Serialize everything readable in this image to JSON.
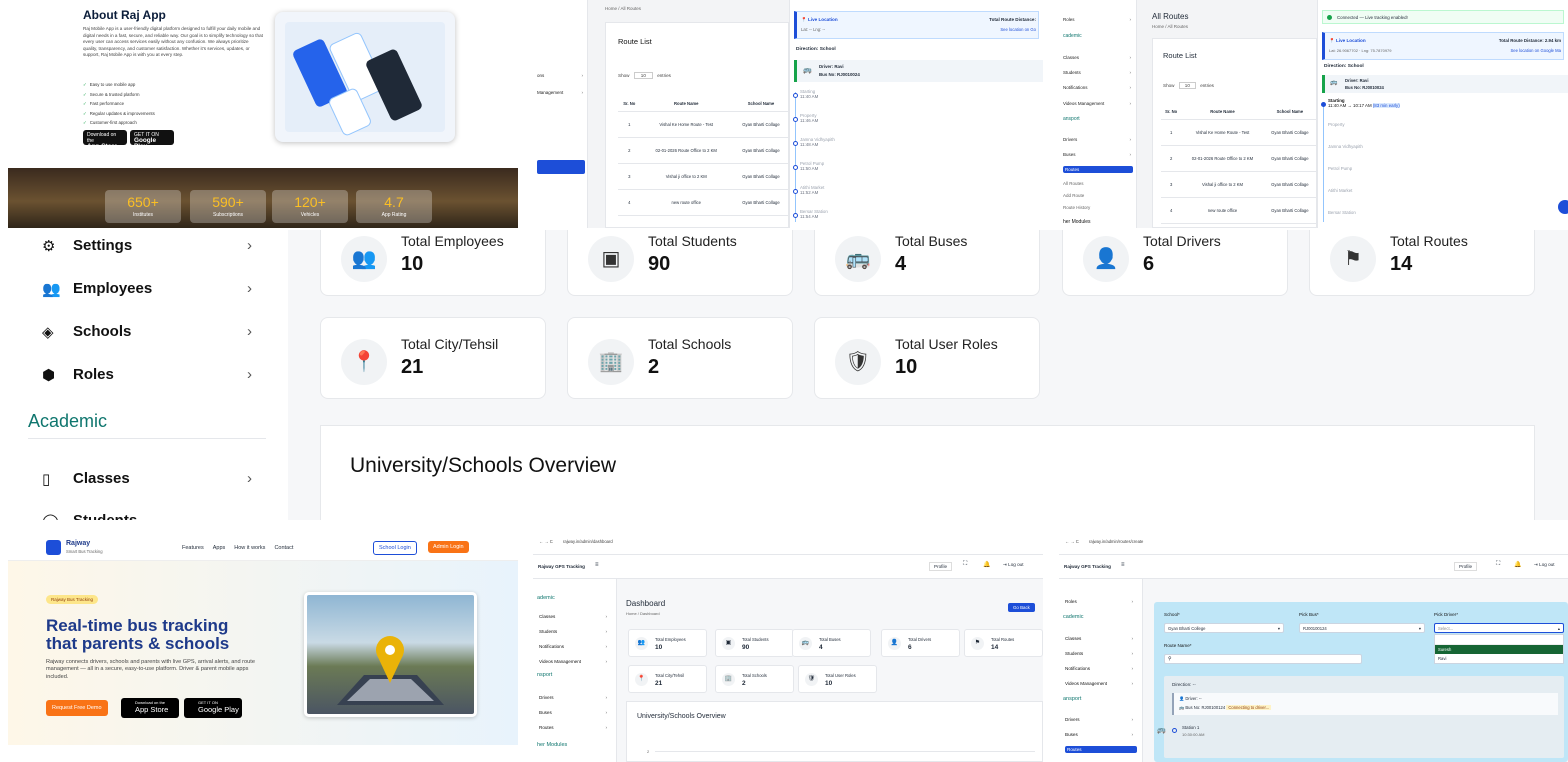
{
  "about": {
    "title": "About Raj App",
    "description": "Raj Mobile App is a user-friendly digital platform designed to fulfill your daily mobile and digital needs in a fast, secure, and reliable way. Our goal is to simplify technology so that every user can access services easily without any confusion. We always prioritize quality, transparency, and customer satisfaction. Whether it's services, updates, or support, Raj Mobile App is with you at every step.",
    "bullets": [
      "Easy to use mobile app",
      "Secure & trusted platform",
      "Fast performance",
      "Regular updates & improvements",
      "Customer-first approach"
    ],
    "appstore": {
      "top": "Download on the",
      "main": "App Store"
    },
    "googleplay": {
      "top": "GET IT ON",
      "main": "Google Play"
    },
    "stats": [
      {
        "value": "650+",
        "label": "Institutes"
      },
      {
        "value": "590+",
        "label": "Subscriptions"
      },
      {
        "value": "120+",
        "label": "Vehicles"
      },
      {
        "value": "4.7",
        "label": "App Rating"
      }
    ]
  },
  "routes_b": {
    "breadcrumb": "Home / All Routes",
    "list_title": "Route List",
    "show": "Show",
    "entries": "entries",
    "page_len": "10",
    "headers": [
      "Sr. No",
      "Route Name",
      "School Name"
    ],
    "rows": [
      [
        "1",
        "Vishal Ke Home Route - Test",
        "Gyan Bharti Collage"
      ],
      [
        "2",
        "02-01-2026 Route Office to 2 KM",
        "Gyan Bharti Collage"
      ],
      [
        "3",
        "Vishal ji office to 2 KM",
        "Gyan Bharti Collage"
      ],
      [
        "4",
        "new route office",
        "Gyan Bharti Collage"
      ]
    ],
    "sidebar": [
      "ons",
      "Management"
    ],
    "live_label": "Live Location",
    "latlng": "Lat: -- Lng: --",
    "dist_label": "Total Route Distance:",
    "see_link": "See location on Go",
    "direction": "Direction: School",
    "driver": "Driver: Ravi",
    "bus": "Bus No: RJ0010024",
    "stops": [
      {
        "name": "Starting",
        "time": "11:40 AM"
      },
      {
        "name": "Property",
        "time": "11:46 AM"
      },
      {
        "name": "Jamna Vidhyapith",
        "time": "11:48 AM"
      },
      {
        "name": "Petrol Pump",
        "time": "11:50 AM"
      },
      {
        "name": "Atithi Market",
        "time": "11:52 AM"
      },
      {
        "name": "Bersar Station",
        "time": "11:54 AM"
      }
    ]
  },
  "routes_c": {
    "title": "All Routes",
    "breadcrumb": "Home / All Routes",
    "list_title": "Route List",
    "sidebar_items": [
      "Roles",
      "Classes",
      "Students",
      "Notifications",
      "Videos Management",
      "Drivers",
      "Buses",
      "Routes",
      "All Routes",
      "Add Route",
      "Route History"
    ],
    "academic": "cademic",
    "transport": "ansport",
    "other": "her Modules",
    "connected": "Connected — Live tracking enabled!",
    "live_label": "Live Location",
    "latlng": "Lat: 26.9067702 · Lng: 75.7870979",
    "dist": "Total Route Distance: 2.94 km",
    "see_link": "See location on Google Ma",
    "direction": "Direction: School",
    "driver": "Driver: Ravi",
    "bus": "Bus No: RJ0010024",
    "stop_start": "Starting",
    "stop_start_time": "11:40 AM → 10:17 AM",
    "early": "(83 min early)",
    "stops": [
      "Property",
      "Jamna Vidhyapith",
      "Petrol Pump",
      "Atithi Market",
      "Bersar Station"
    ]
  },
  "dashboard": {
    "nav": [
      {
        "label": "Settings"
      },
      {
        "label": "Employees"
      },
      {
        "label": "Schools"
      },
      {
        "label": "Roles"
      }
    ],
    "academic": "Academic",
    "nav2": [
      {
        "label": "Classes"
      },
      {
        "label": "Students"
      }
    ],
    "cards_top": [
      {
        "label": "Total Employees",
        "value": "10"
      },
      {
        "label": "Total Students",
        "value": "90"
      },
      {
        "label": "Total Buses",
        "value": "4"
      },
      {
        "label": "Total Drivers",
        "value": "6"
      },
      {
        "label": "Total Routes",
        "value": "14"
      }
    ],
    "cards": [
      {
        "label": "Total City/Tehsil",
        "value": "21"
      },
      {
        "label": "Total Schools",
        "value": "2"
      },
      {
        "label": "Total User Roles",
        "value": "10"
      }
    ],
    "overview": "University/Schools Overview"
  },
  "landing": {
    "brand": "Rajway",
    "tagline": "Smart Bus Tracking",
    "nav": [
      "Features",
      "Apps",
      "How it works",
      "Contact"
    ],
    "school_login": "School Login",
    "admin_login": "Admin Login",
    "badge": "Rajway Bus Tracking",
    "headline1": "Real-time bus tracking",
    "headline2": "that parents & schools",
    "desc": "Rajway connects drivers, schools and parents with live GPS, arrival alerts, and route management — all in a secure, easy-to-use platform. Driver & parent mobile apps included.",
    "demo": "Request Free Demo",
    "appstore_top": "Download on the",
    "appstore": "App Store",
    "gp_top": "GET IT ON",
    "gp": "Google Play"
  },
  "dash_small": {
    "url": "rajway.in/admin/dashboard",
    "brand": "Rajway GPS Tracking",
    "profile": "Profile",
    "logout": "Log out",
    "title": "Dashboard",
    "breadcrumb": "Home / Dashboard",
    "goback": "Go Back",
    "sidebar": [
      "Classes",
      "Students",
      "Notifications",
      "Videos Management",
      "Drivers",
      "Buses",
      "Routes"
    ],
    "academic": "ademic",
    "transport": "nsport",
    "other": "her Modules",
    "cards": [
      {
        "label": "Total Employees",
        "value": "10"
      },
      {
        "label": "Total Students",
        "value": "90"
      },
      {
        "label": "Total Buses",
        "value": "4"
      },
      {
        "label": "Total Drivers",
        "value": "6"
      },
      {
        "label": "Total Routes",
        "value": "14"
      },
      {
        "label": "Total City/Tehsil",
        "value": "21"
      },
      {
        "label": "Total Schools",
        "value": "2"
      },
      {
        "label": "Total User Roles",
        "value": "10"
      }
    ],
    "overview": "University/Schools Overview",
    "axis_tick": "2"
  },
  "create_route": {
    "url": "rajway.in/admin/routes/create",
    "brand": "Rajway GPS Tracking",
    "profile": "Profile",
    "logout": "Log out",
    "sidebar": [
      "Roles",
      "Classes",
      "Students",
      "Notifications",
      "Videos Management",
      "Drivers",
      "Buses",
      "Routes"
    ],
    "academic": "cademic",
    "transport": "ansport",
    "school_label": "School*",
    "school_value": "Gyan Bharti College",
    "bus_label": "Pick Bus*",
    "bus_value": "RJ00100124",
    "driver_label": "Pick Driver*",
    "driver_placeholder": "Select...",
    "driver_options": [
      "Suresh",
      "Ravi"
    ],
    "route_label": "Route Name*",
    "direction": "Direction: --",
    "driver_line": "Driver: --",
    "bus_line": "Bus No: RJ00100124",
    "connecting": "Connecting to driver...",
    "station": "Station 1",
    "station_time": "10:30:00 AM"
  }
}
